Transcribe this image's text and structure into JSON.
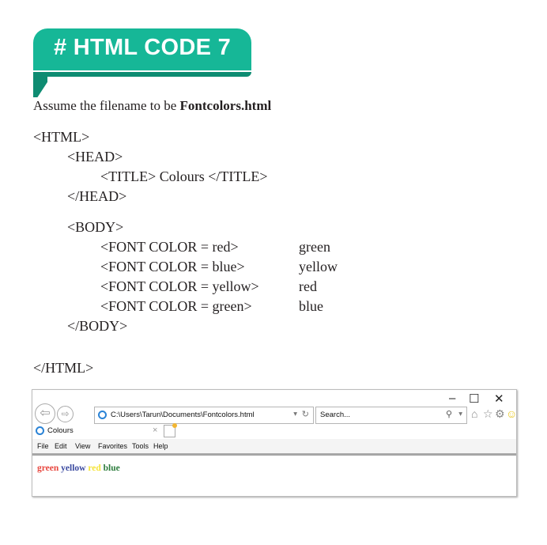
{
  "banner": {
    "title": "# HTML CODE 7"
  },
  "intro": {
    "prefix": "Assume the filename to be ",
    "filename": "Fontcolors.html"
  },
  "code": {
    "html_open": "<HTML>",
    "head_open": "<HEAD>",
    "title_line": "<TITLE> Colours </TITLE>",
    "head_close": "</HEAD>",
    "body_open": "<BODY>",
    "font_lines": [
      {
        "tag": "<FONT COLOR = red>",
        "text": "green"
      },
      {
        "tag": "<FONT COLOR = blue>",
        "text": "yellow"
      },
      {
        "tag": "<FONT COLOR = yellow>",
        "text": "red"
      },
      {
        "tag": "<FONT COLOR = green>",
        "text": "blue"
      }
    ],
    "body_close": "</BODY>",
    "html_close": "</HTML>"
  },
  "browser": {
    "window_controls": {
      "minimize": "–",
      "maximize": "☐",
      "close": "✕"
    },
    "address": "C:\\Users\\Tarun\\Documents\\Fontcolors.html",
    "address_dropdown": "▾",
    "refresh_icon": "↻",
    "search_placeholder": "Search...",
    "search_icon": "⚲",
    "search_dropdown": "▾",
    "toolbar_icons": {
      "home": "⌂",
      "favorites": "☆",
      "settings": "⚙",
      "feedback": "☺"
    },
    "tab": {
      "label": "Colours",
      "close": "×"
    },
    "menu": [
      "File",
      "Edit",
      "View",
      "Favorites",
      "Tools",
      "Help"
    ],
    "output_words": [
      {
        "text": "green",
        "color": "#e8473f"
      },
      {
        "text": "yellow",
        "color": "#3b4aa0"
      },
      {
        "text": "red",
        "color": "#f5e43a"
      },
      {
        "text": "blue",
        "color": "#2e7d3e"
      }
    ]
  },
  "colors": {
    "banner": "#16b797",
    "banner_dark": "#0e8c72"
  }
}
